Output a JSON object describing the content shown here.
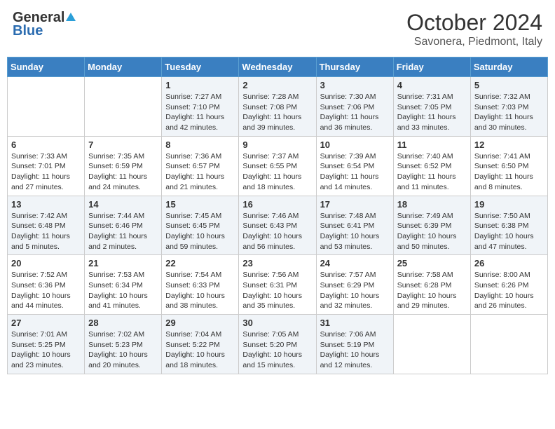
{
  "header": {
    "logo_general": "General",
    "logo_blue": "Blue",
    "month_title": "October 2024",
    "location": "Savonera, Piedmont, Italy"
  },
  "columns": [
    "Sunday",
    "Monday",
    "Tuesday",
    "Wednesday",
    "Thursday",
    "Friday",
    "Saturday"
  ],
  "weeks": [
    [
      {
        "day": "",
        "text": ""
      },
      {
        "day": "",
        "text": ""
      },
      {
        "day": "1",
        "text": "Sunrise: 7:27 AM\nSunset: 7:10 PM\nDaylight: 11 hours and 42 minutes."
      },
      {
        "day": "2",
        "text": "Sunrise: 7:28 AM\nSunset: 7:08 PM\nDaylight: 11 hours and 39 minutes."
      },
      {
        "day": "3",
        "text": "Sunrise: 7:30 AM\nSunset: 7:06 PM\nDaylight: 11 hours and 36 minutes."
      },
      {
        "day": "4",
        "text": "Sunrise: 7:31 AM\nSunset: 7:05 PM\nDaylight: 11 hours and 33 minutes."
      },
      {
        "day": "5",
        "text": "Sunrise: 7:32 AM\nSunset: 7:03 PM\nDaylight: 11 hours and 30 minutes."
      }
    ],
    [
      {
        "day": "6",
        "text": "Sunrise: 7:33 AM\nSunset: 7:01 PM\nDaylight: 11 hours and 27 minutes."
      },
      {
        "day": "7",
        "text": "Sunrise: 7:35 AM\nSunset: 6:59 PM\nDaylight: 11 hours and 24 minutes."
      },
      {
        "day": "8",
        "text": "Sunrise: 7:36 AM\nSunset: 6:57 PM\nDaylight: 11 hours and 21 minutes."
      },
      {
        "day": "9",
        "text": "Sunrise: 7:37 AM\nSunset: 6:55 PM\nDaylight: 11 hours and 18 minutes."
      },
      {
        "day": "10",
        "text": "Sunrise: 7:39 AM\nSunset: 6:54 PM\nDaylight: 11 hours and 14 minutes."
      },
      {
        "day": "11",
        "text": "Sunrise: 7:40 AM\nSunset: 6:52 PM\nDaylight: 11 hours and 11 minutes."
      },
      {
        "day": "12",
        "text": "Sunrise: 7:41 AM\nSunset: 6:50 PM\nDaylight: 11 hours and 8 minutes."
      }
    ],
    [
      {
        "day": "13",
        "text": "Sunrise: 7:42 AM\nSunset: 6:48 PM\nDaylight: 11 hours and 5 minutes."
      },
      {
        "day": "14",
        "text": "Sunrise: 7:44 AM\nSunset: 6:46 PM\nDaylight: 11 hours and 2 minutes."
      },
      {
        "day": "15",
        "text": "Sunrise: 7:45 AM\nSunset: 6:45 PM\nDaylight: 10 hours and 59 minutes."
      },
      {
        "day": "16",
        "text": "Sunrise: 7:46 AM\nSunset: 6:43 PM\nDaylight: 10 hours and 56 minutes."
      },
      {
        "day": "17",
        "text": "Sunrise: 7:48 AM\nSunset: 6:41 PM\nDaylight: 10 hours and 53 minutes."
      },
      {
        "day": "18",
        "text": "Sunrise: 7:49 AM\nSunset: 6:39 PM\nDaylight: 10 hours and 50 minutes."
      },
      {
        "day": "19",
        "text": "Sunrise: 7:50 AM\nSunset: 6:38 PM\nDaylight: 10 hours and 47 minutes."
      }
    ],
    [
      {
        "day": "20",
        "text": "Sunrise: 7:52 AM\nSunset: 6:36 PM\nDaylight: 10 hours and 44 minutes."
      },
      {
        "day": "21",
        "text": "Sunrise: 7:53 AM\nSunset: 6:34 PM\nDaylight: 10 hours and 41 minutes."
      },
      {
        "day": "22",
        "text": "Sunrise: 7:54 AM\nSunset: 6:33 PM\nDaylight: 10 hours and 38 minutes."
      },
      {
        "day": "23",
        "text": "Sunrise: 7:56 AM\nSunset: 6:31 PM\nDaylight: 10 hours and 35 minutes."
      },
      {
        "day": "24",
        "text": "Sunrise: 7:57 AM\nSunset: 6:29 PM\nDaylight: 10 hours and 32 minutes."
      },
      {
        "day": "25",
        "text": "Sunrise: 7:58 AM\nSunset: 6:28 PM\nDaylight: 10 hours and 29 minutes."
      },
      {
        "day": "26",
        "text": "Sunrise: 8:00 AM\nSunset: 6:26 PM\nDaylight: 10 hours and 26 minutes."
      }
    ],
    [
      {
        "day": "27",
        "text": "Sunrise: 7:01 AM\nSunset: 5:25 PM\nDaylight: 10 hours and 23 minutes."
      },
      {
        "day": "28",
        "text": "Sunrise: 7:02 AM\nSunset: 5:23 PM\nDaylight: 10 hours and 20 minutes."
      },
      {
        "day": "29",
        "text": "Sunrise: 7:04 AM\nSunset: 5:22 PM\nDaylight: 10 hours and 18 minutes."
      },
      {
        "day": "30",
        "text": "Sunrise: 7:05 AM\nSunset: 5:20 PM\nDaylight: 10 hours and 15 minutes."
      },
      {
        "day": "31",
        "text": "Sunrise: 7:06 AM\nSunset: 5:19 PM\nDaylight: 10 hours and 12 minutes."
      },
      {
        "day": "",
        "text": ""
      },
      {
        "day": "",
        "text": ""
      }
    ]
  ]
}
